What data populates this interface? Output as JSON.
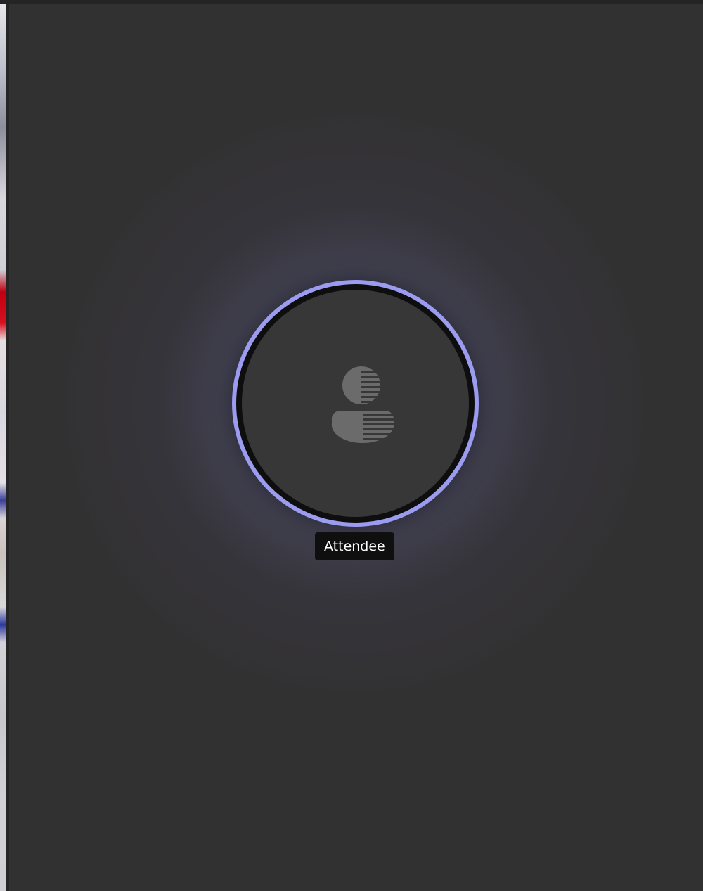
{
  "participant": {
    "name": "Attendee",
    "avatar_icon": "person-icon",
    "speaking_ring_color": "#9b9cf0"
  },
  "colors": {
    "stage_background": "#323132",
    "badge_background": "#0f0f10"
  }
}
